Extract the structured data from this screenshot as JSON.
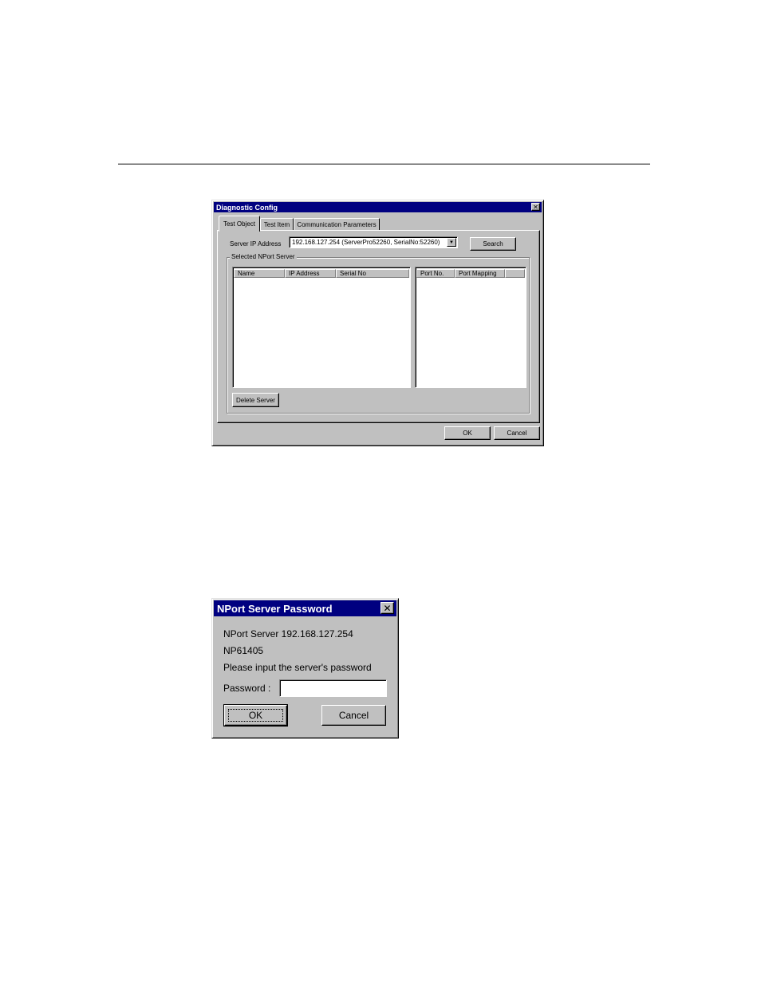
{
  "diagnostic_dialog": {
    "title": "Diagnostic Config",
    "close_glyph": "✕",
    "tabs": [
      {
        "label": "Test Object",
        "active": true
      },
      {
        "label": "Test Item",
        "active": false
      },
      {
        "label": "Communication Parameters",
        "active": false
      }
    ],
    "server_ip_label": "Server IP Address",
    "server_ip_value": "192.168.127.254 (ServerPro52260, SerialNo:52260)",
    "search_label": "Search",
    "group_title": "Selected NPort Server",
    "server_columns": [
      "Name",
      "IP Address",
      "Serial No"
    ],
    "port_columns": [
      "Port No.",
      "Port Mapping"
    ],
    "delete_label": "Delete Server",
    "ok_label": "OK",
    "cancel_label": "Cancel",
    "dropdown_icon": "chevron-down-icon"
  },
  "password_dialog": {
    "title": "NPort Server Password",
    "close_glyph": "✕",
    "server_line": "NPort Server 192.168.127.254",
    "model_line": "NP61405",
    "prompt": "Please input the server's password",
    "password_label": "Password :",
    "password_value": "",
    "ok_label": "OK",
    "cancel_label": "Cancel"
  },
  "colors": {
    "titlebar": "#000080",
    "face": "#c0c0c0"
  }
}
